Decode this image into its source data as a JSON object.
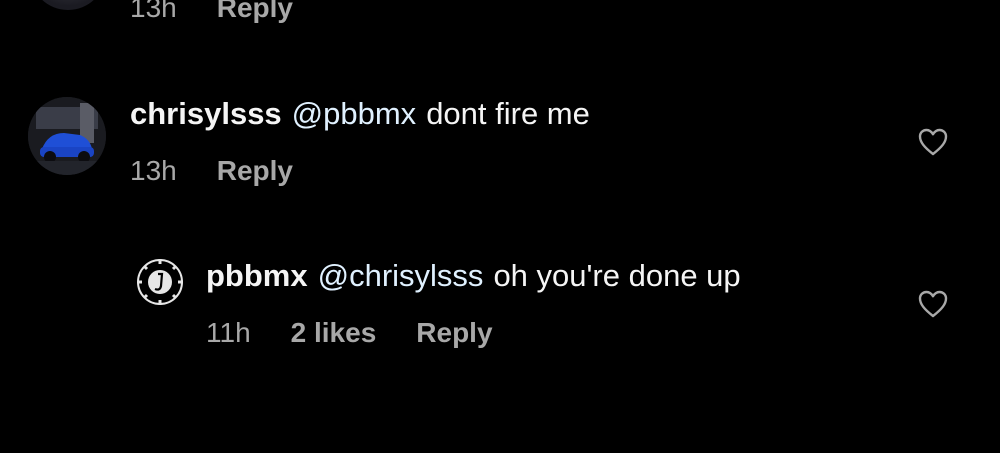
{
  "prev_comment": {
    "time": "13h",
    "reply_label": "Reply"
  },
  "comments": [
    {
      "username": "chrisylsss",
      "mention": "@pbbmx",
      "text": "dont fire me",
      "time": "13h",
      "reply_label": "Reply",
      "avatar_icon": "blue-car-avatar"
    },
    {
      "username": "pbbmx",
      "mention": "@chrisylsss",
      "text": "oh you're done up",
      "time": "11h",
      "likes": "2 likes",
      "reply_label": "Reply",
      "avatar_icon": "pbbmx-gear-logo"
    }
  ],
  "colors": {
    "background": "#000000",
    "text_primary": "#f5f5f5",
    "text_secondary": "#a8a8a8",
    "mention": "#e0f1ff"
  },
  "icons": {
    "like": "heart-outline-icon"
  }
}
